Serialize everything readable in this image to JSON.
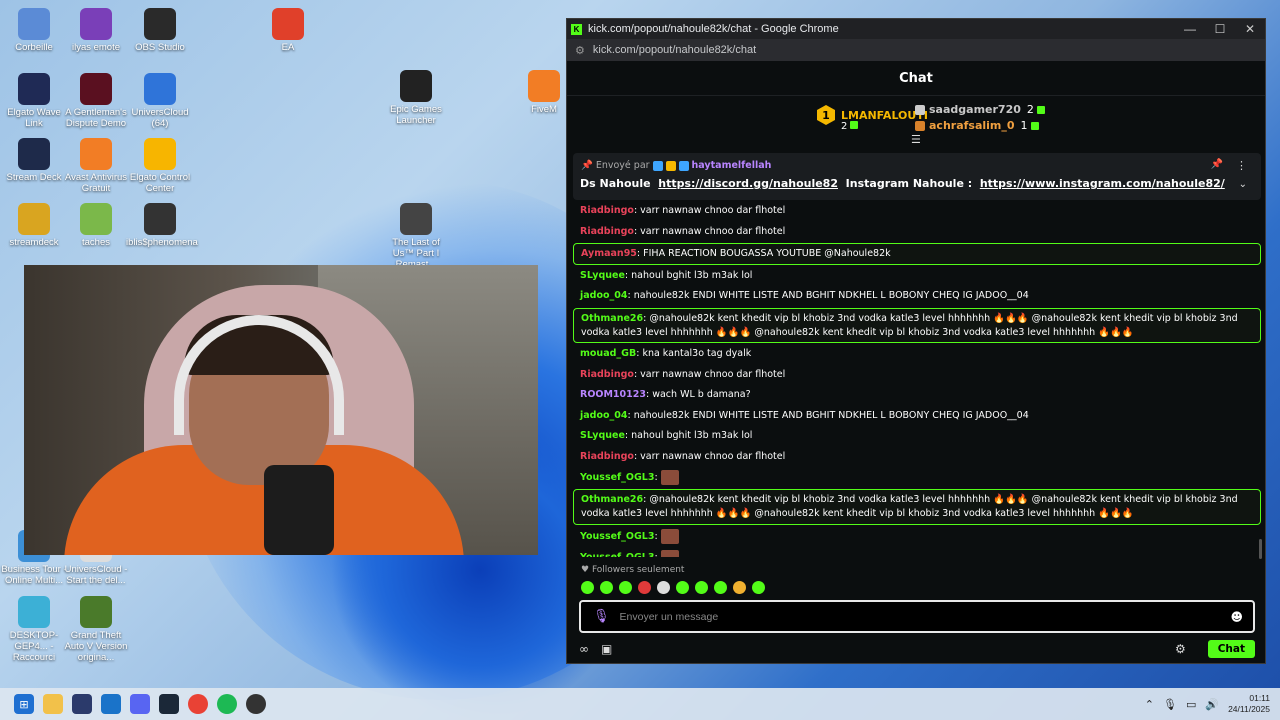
{
  "desktop_icons": [
    {
      "label": "Corbeille",
      "color": "#5b8bd6"
    },
    {
      "label": "ilyas emote",
      "color": "#7a3fb8"
    },
    {
      "label": "OBS Studio",
      "color": "#2a2a2a"
    },
    {
      "label": "EA",
      "color": "#e0402a"
    },
    {
      "label": "Elgato Wave Link",
      "color": "#1f2a55"
    },
    {
      "label": "A Gentleman's Dispute Demo",
      "color": "#5a1020"
    },
    {
      "label": "UniversCloud (64)",
      "color": "#2f74d9"
    },
    {
      "label": "Epic Games Launcher",
      "color": "#222"
    },
    {
      "label": "FiveM",
      "color": "#f27d25"
    },
    {
      "label": "Stream Deck",
      "color": "#1e2a4a"
    },
    {
      "label": "Avast Antivirus Gratuit",
      "color": "#f27d25"
    },
    {
      "label": "Elgato Control Center",
      "color": "#f7b500"
    },
    {
      "label": "streamdeck",
      "color": "#d9a520"
    },
    {
      "label": "taches",
      "color": "#7bb84a"
    },
    {
      "label": "iblis$phenomena",
      "color": "#333"
    },
    {
      "label": "The Last of Us™ Part I Remast...",
      "color": "#444"
    },
    {
      "label": "Business Tour - Online Multi...",
      "color": "#3c8fd6"
    },
    {
      "label": "UniversCloud - Start the del...",
      "color": "#ddd"
    },
    {
      "label": "DESKTOP-GEP4... - Raccourci",
      "color": "#3cb0d6"
    },
    {
      "label": "Grand Theft Auto V Version origina...",
      "color": "#4a7a2a"
    }
  ],
  "window": {
    "title": "kick.com/popout/nahoule82k/chat - Google Chrome",
    "url": "kick.com/popout/nahoule82k/chat"
  },
  "chat": {
    "header": "Chat",
    "leaderboard": {
      "top": {
        "rank": "1",
        "name": "LMANFALOUTI",
        "count": "2"
      },
      "second": {
        "name": "saadgamer720",
        "count": "2"
      },
      "third": {
        "name": "achrafsalim_0",
        "count": "1"
      }
    },
    "pinned": {
      "sent_by_label": "Envoyé par",
      "sender": "haytamelfellah",
      "text_prefix": "Ds Nahoule",
      "discord_link": "https://discord.gg/nahoule82",
      "text_middle": "Instagram Nahoule :",
      "instagram_link": "https://www.instagram.com/nahoule82/"
    },
    "messages": [
      {
        "user": "Riadbingo",
        "color": "#e8435a",
        "text": "varr nawnaw chnoo dar flhotel",
        "hl": false
      },
      {
        "user": "Riadbingo",
        "color": "#e8435a",
        "text": "varr nawnaw chnoo dar flhotel",
        "hl": false
      },
      {
        "user": "Aymaan95",
        "color": "#e8435a",
        "text": "FIHA REACTION BOUGASSA YOUTUBE @Nahoule82k",
        "hl": true
      },
      {
        "user": "SLyquee",
        "color": "#53fc18",
        "text": "nahoul bghit l3b m3ak lol",
        "hl": false
      },
      {
        "user": "jadoo_04",
        "color": "#53fc18",
        "text": "nahoule82k ENDI WHITE LISTE AND BGHIT NDKHEL L BOBONY CHEQ IG JADOO__04",
        "hl": false
      },
      {
        "user": "Othmane26",
        "color": "#53fc18",
        "text": "@nahoule82k kent khedit vip bl khobiz 3nd vodka katle3 level hhhhhhh 🔥🔥🔥 @nahoule82k kent khedit vip bl khobiz 3nd vodka katle3 level hhhhhhh 🔥🔥🔥 @nahoule82k kent khedit vip bl khobiz 3nd vodka katle3 level hhhhhhh 🔥🔥🔥",
        "hl": true
      },
      {
        "user": "mouad_GB",
        "color": "#53fc18",
        "text": "kna kantal3o tag dyalk",
        "hl": false
      },
      {
        "user": "Riadbingo",
        "color": "#e8435a",
        "text": "varr nawnaw chnoo dar flhotel",
        "hl": false
      },
      {
        "user": "ROOM10123",
        "color": "#b985ff",
        "text": "wach WL b damana?",
        "hl": false
      },
      {
        "user": "jadoo_04",
        "color": "#53fc18",
        "text": "nahoule82k ENDI WHITE LISTE AND BGHIT NDKHEL L BOBONY CHEQ IG JADOO__04",
        "hl": false
      },
      {
        "user": "SLyquee",
        "color": "#53fc18",
        "text": "nahoul bghit l3b m3ak lol",
        "hl": false
      },
      {
        "user": "Riadbingo",
        "color": "#e8435a",
        "text": "varr nawnaw chnoo dar flhotel",
        "hl": false
      },
      {
        "user": "Youssef_OGL3",
        "color": "#53fc18",
        "text": "",
        "hl": false
      },
      {
        "user": "Othmane26",
        "color": "#53fc18",
        "text": "@nahoule82k kent khedit vip bl khobiz 3nd vodka katle3 level hhhhhhh 🔥🔥🔥 @nahoule82k kent khedit vip bl khobiz 3nd vodka katle3 level hhhhhhh 🔥🔥🔥 @nahoule82k kent khedit vip bl khobiz 3nd vodka katle3 level hhhhhhh 🔥🔥🔥",
        "hl": true
      },
      {
        "user": "Youssef_OGL3",
        "color": "#53fc18",
        "text": "",
        "hl": false
      },
      {
        "user": "Youssef_OGL3",
        "color": "#53fc18",
        "text": "",
        "hl": false
      }
    ],
    "followers_label": "Followers seulement",
    "input_placeholder": "Envoyer un message",
    "send_label": "Chat"
  },
  "taskbar": {
    "time": "01:11",
    "date": "24/11/2025"
  },
  "colors": {
    "kick_green": "#53fc18",
    "background": "#0b0e0f"
  }
}
